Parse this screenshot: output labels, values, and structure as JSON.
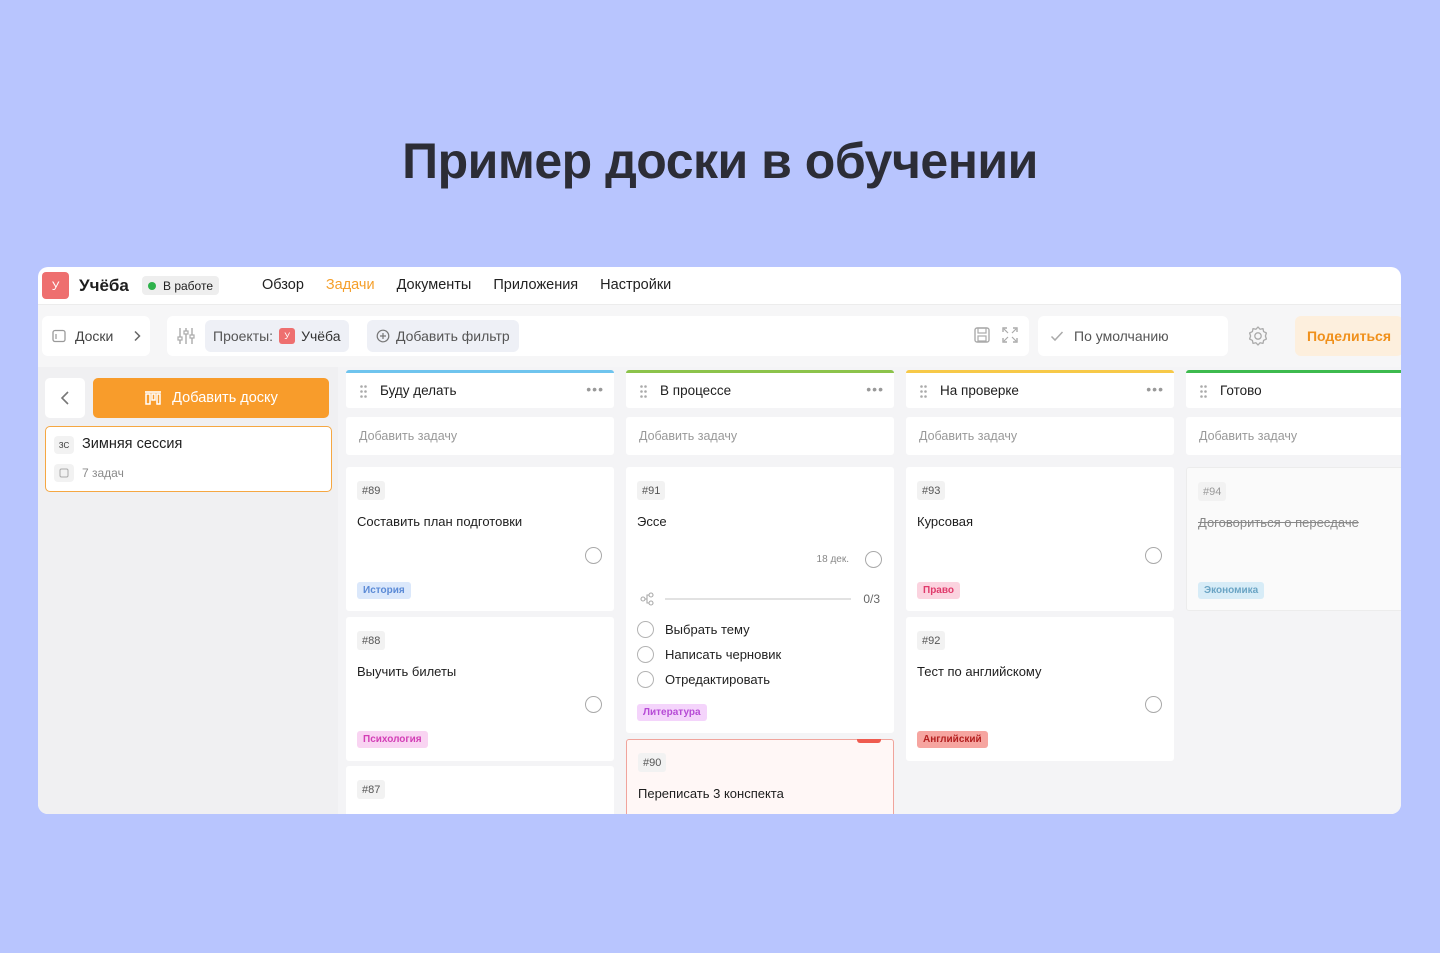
{
  "hero_title": "Пример доски в обучении",
  "topbar": {
    "project_avatar": "У",
    "project_name": "Учёба",
    "status": "В работе",
    "nav": [
      "Обзор",
      "Задачи",
      "Документы",
      "Приложения",
      "Настройки"
    ],
    "active_nav": "Задачи"
  },
  "toolbar": {
    "boards_label": "Доски",
    "projects_label": "Проекты:",
    "projects_avatar": "У",
    "projects_value": "Учёба",
    "add_filter_label": "Добавить фильтр",
    "default_view_label": "По умолчанию",
    "share_label": "Поделиться"
  },
  "sidebar": {
    "add_board_label": "Добавить доску",
    "board": {
      "abbr": "ЗС",
      "title": "Зимняя сессия",
      "count": "7 задач"
    }
  },
  "add_task_label": "Добавить задачу",
  "colors": {
    "accent": "#f89c2b",
    "col_todo": "#6fc4ee",
    "col_progress": "#8cc34b",
    "col_review": "#f7c948",
    "col_done": "#3dba4e"
  },
  "columns": [
    {
      "title": "Буду делать",
      "cards": [
        {
          "id": "#89",
          "title": "Составить план подготовки",
          "tag": "История"
        },
        {
          "id": "#88",
          "title": "Выучить билеты",
          "tag": "Психология"
        },
        {
          "id": "#87",
          "title": ""
        }
      ]
    },
    {
      "title": "В процессе",
      "cards": [
        {
          "id": "#91",
          "title": "Эссе",
          "date": "18 дек.",
          "progress": "0/3",
          "subtasks": [
            "Выбрать тему",
            "Написать черновик",
            "Отредактировать"
          ],
          "tag": "Литература"
        },
        {
          "id": "#90",
          "title": "Переписать 3 конспекта"
        }
      ]
    },
    {
      "title": "На проверке",
      "cards": [
        {
          "id": "#93",
          "title": "Курсовая",
          "tag": "Право"
        },
        {
          "id": "#92",
          "title": "Тест по английскому",
          "tag": "Английский"
        }
      ]
    },
    {
      "title": "Готово",
      "cards": [
        {
          "id": "#94",
          "title": "Договориться о пересдаче",
          "tag": "Экономика"
        }
      ]
    }
  ]
}
